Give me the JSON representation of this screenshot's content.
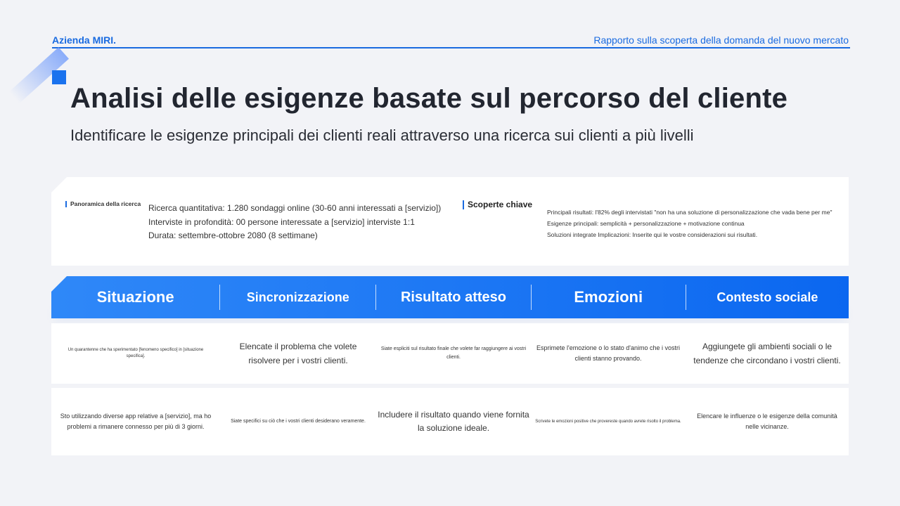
{
  "header": {
    "company": "Azienda MIRI.",
    "report": "Rapporto sulla scoperta della domanda del nuovo mercato"
  },
  "title": "Analisi delle esigenze basate sul percorso del cliente",
  "subtitle": "Identificare le esigenze principali dei clienti reali attraverso una ricerca sui clienti a più livelli",
  "overview": {
    "label": "Panoramica della ricerca",
    "lines": [
      "Ricerca quantitativa: 1.280 sondaggi online (30-60 anni interessati a [servizio])",
      "Interviste in profondità: 00 persone interessate a [servizio] interviste 1:1",
      "Durata: settembre-ottobre 2080 (8 settimane)"
    ],
    "key_label": "Scoperte chiave",
    "key_lines": [
      "Principali risultati: l'82% degli intervistati \"non ha una soluzione di personalizzazione che vada bene per me\"",
      "Esigenze principali: semplicità + personalizzazione + motivazione continua",
      "Soluzioni integrate Implicazioni: Inserite qui le vostre considerazioni sui risultati."
    ]
  },
  "columns": [
    "Situazione",
    "Sincronizzazione",
    "Risultato atteso",
    "Emozioni",
    "Contesto sociale"
  ],
  "rows": [
    [
      "Un quarantenne che ha sperimentato [fenomeno specifico] in [situazione specifica].",
      "Elencate il problema che volete risolvere per i vostri clienti.",
      "Siate espliciti sul risultato finale che volete far raggiungere ai vostri clienti.",
      "Esprimete l'emozione o lo stato d'animo che i vostri clienti stanno provando.",
      "Aggiungete gli ambienti sociali o le tendenze che circondano i vostri clienti."
    ],
    [
      "Sto utilizzando diverse app relative a [servizio], ma ho problemi a rimanere connesso per più di 3 giorni.",
      "Siate specifici su ciò che i vostri clienti desiderano veramente.",
      "Includere il risultato quando viene fornita la soluzione ideale.",
      "Scrivete le emozioni positive che provereste quando avrete risolto il problema.",
      "Elencare le influenze o le esigenze della comunità nelle vicinanze."
    ]
  ]
}
